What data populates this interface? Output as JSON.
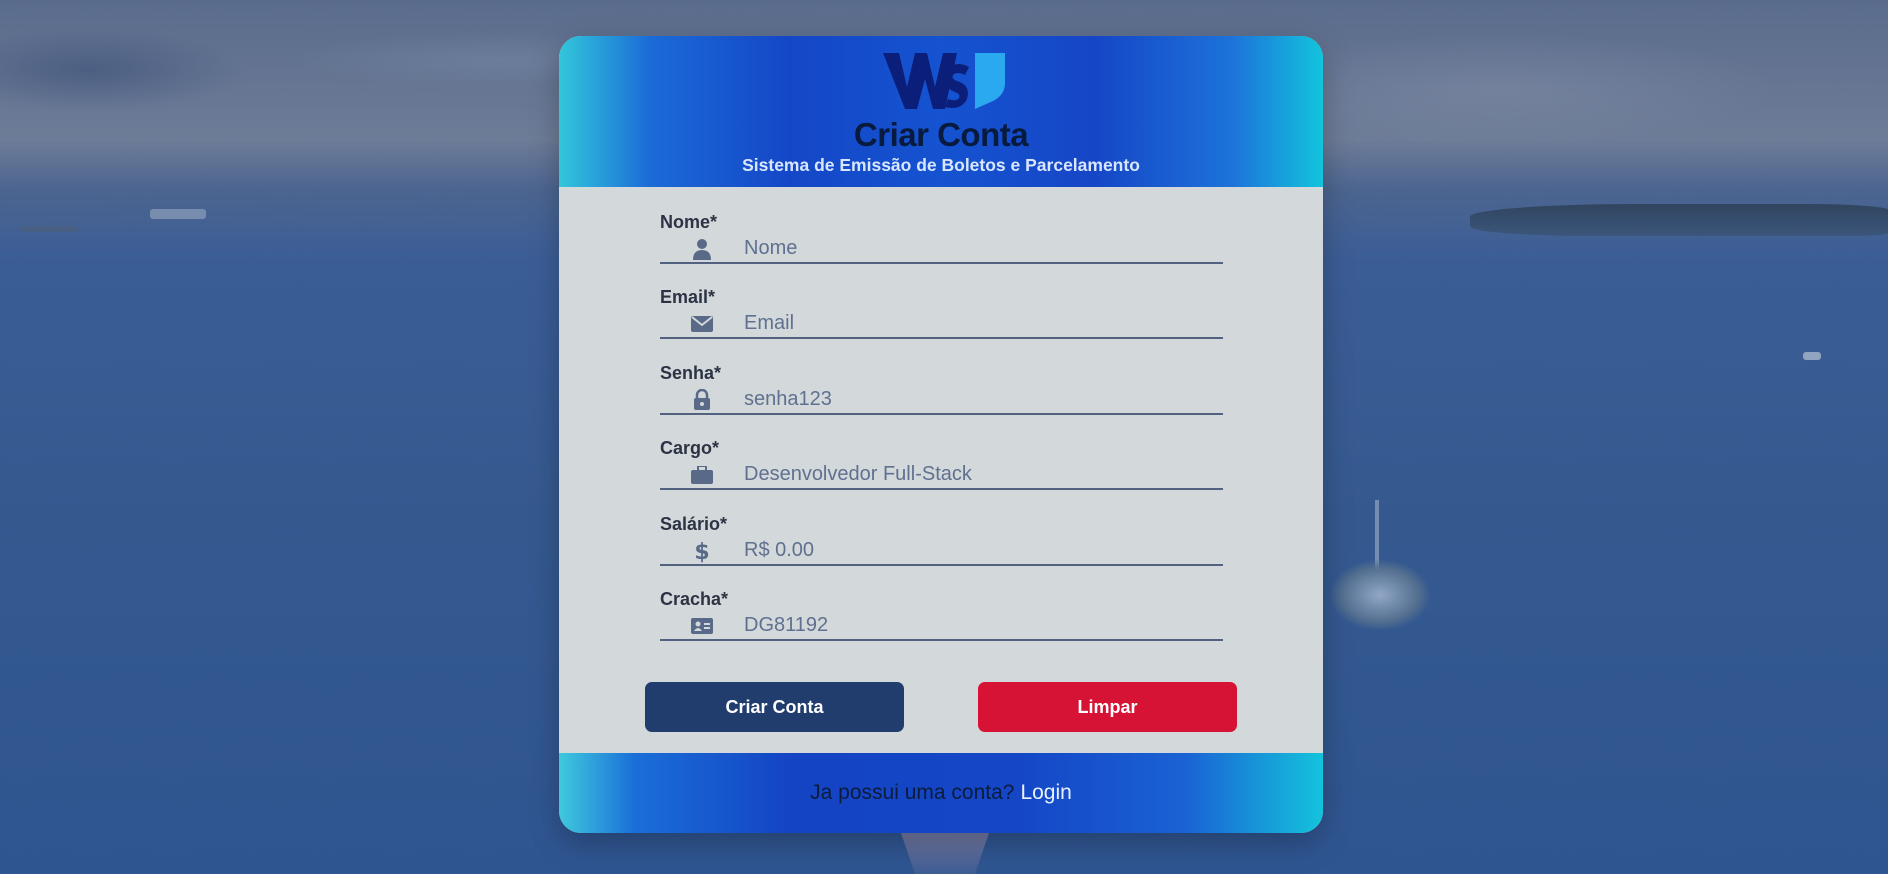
{
  "header": {
    "title": "Criar Conta",
    "subtitle": "Sistema de Emissão de Boletos e Parcelamento",
    "logo_icon": "ws-logo-icon"
  },
  "form": {
    "fields": [
      {
        "label": "Nome*",
        "placeholder": "Nome",
        "value": "",
        "icon": "user-icon"
      },
      {
        "label": "Email*",
        "placeholder": "Email",
        "value": "",
        "icon": "envelope-icon"
      },
      {
        "label": "Senha*",
        "placeholder": "senha123",
        "value": "",
        "icon": "lock-icon"
      },
      {
        "label": "Cargo*",
        "placeholder": "Desenvolvedor Full-Stack",
        "value": "",
        "icon": "briefcase-icon"
      },
      {
        "label": "Salário*",
        "placeholder": "R$ 0.00",
        "value": "",
        "icon": "dollar-icon"
      },
      {
        "label": "Cracha*",
        "placeholder": "DG81192",
        "value": "",
        "icon": "id-card-icon"
      }
    ],
    "submit_label": "Criar Conta",
    "clear_label": "Limpar"
  },
  "footer": {
    "prompt": "Ja possui uma conta?",
    "link_label": "Login"
  },
  "colors": {
    "primary_button": "#213d6e",
    "danger_button": "#d61235",
    "header_blue": "#1447c7",
    "accent_cyan": "#12c4dc",
    "form_background": "#d3d9da"
  }
}
